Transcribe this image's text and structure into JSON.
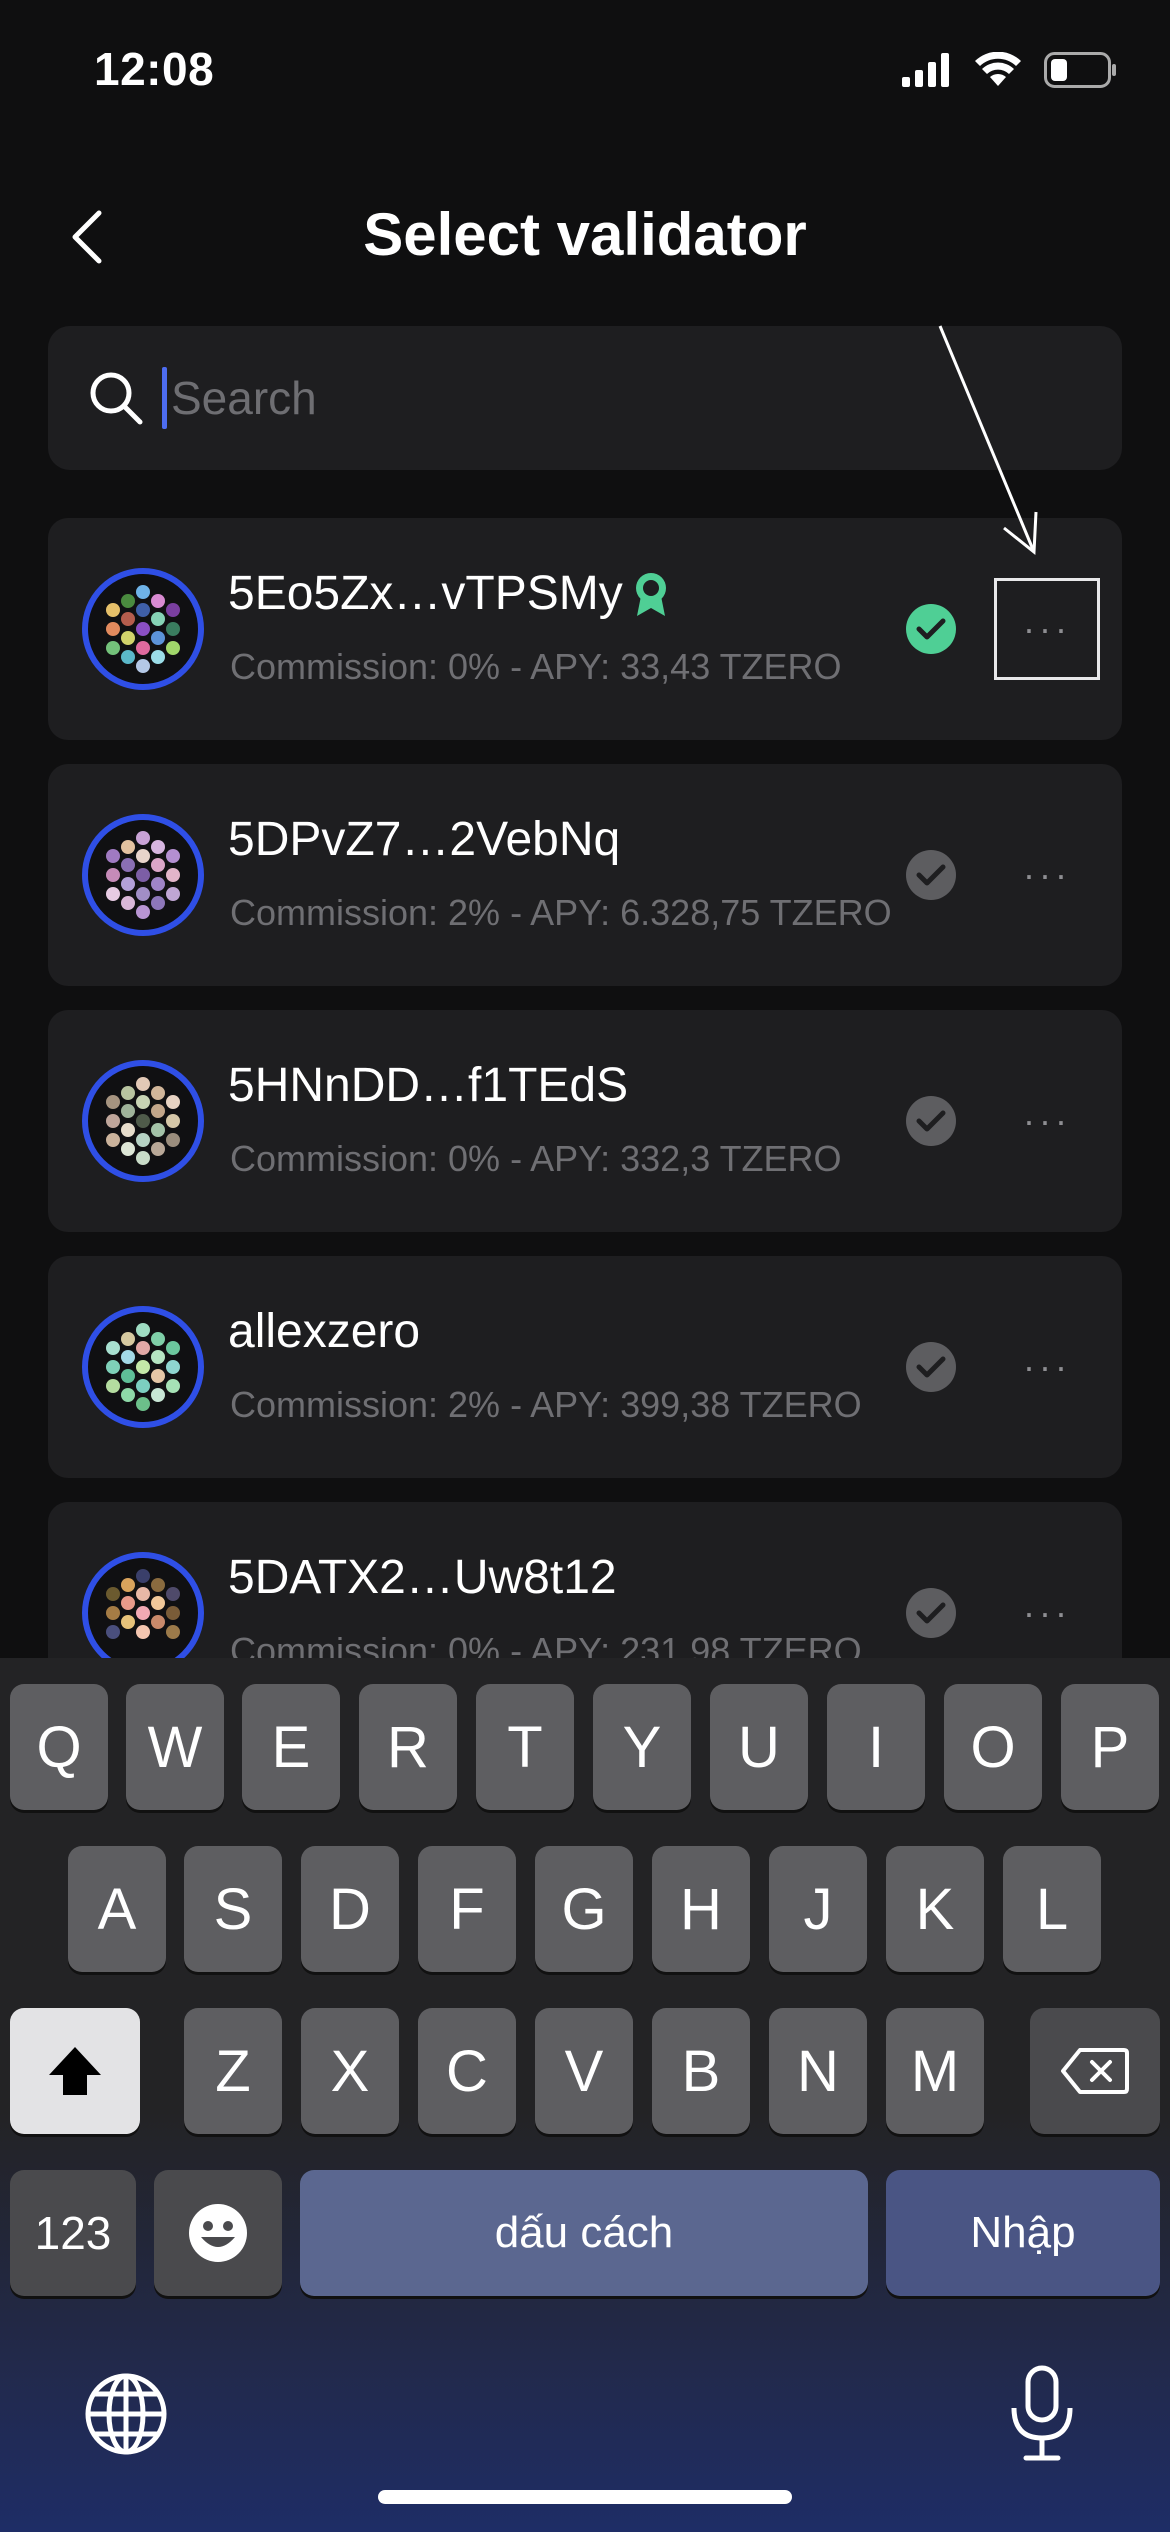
{
  "status_bar": {
    "time": "12:08"
  },
  "header": {
    "title": "Select validator"
  },
  "search": {
    "placeholder": "Search",
    "value": ""
  },
  "colors": {
    "accent": "#2f4fe6",
    "selected_check": "#4fcf95",
    "card_bg": "#1e1e20",
    "meta_text": "#6f6f73"
  },
  "validators": [
    {
      "name": "5Eo5Zx…vTPSMy",
      "badge": "ribbon-badge-icon",
      "meta": "Commission: 0% - APY: 33,43 TZERO",
      "selected": true,
      "more_label": "···"
    },
    {
      "name": "5DPvZ7…2VebNq",
      "meta": "Commission: 2% - APY: 6.328,75 TZERO",
      "selected": false,
      "more_label": "···"
    },
    {
      "name": "5HNnDD…f1TEdS",
      "meta": "Commission: 0% - APY: 332,3 TZERO",
      "selected": false,
      "more_label": "···"
    },
    {
      "name": "allexzero",
      "meta": "Commission: 2% - APY: 399,38 TZERO",
      "selected": false,
      "more_label": "···"
    },
    {
      "name": "5DATX2…Uw8t12",
      "meta": "Commission: 0% - APY: 231,98 TZERO",
      "selected": false,
      "more_label": "···"
    }
  ],
  "keyboard": {
    "row1": [
      "Q",
      "W",
      "E",
      "R",
      "T",
      "Y",
      "U",
      "I",
      "O",
      "P"
    ],
    "row2": [
      "A",
      "S",
      "D",
      "F",
      "G",
      "H",
      "J",
      "K",
      "L"
    ],
    "row3": [
      "Z",
      "X",
      "C",
      "V",
      "B",
      "N",
      "M"
    ],
    "numbers_label": "123",
    "space_label": "dấu cách",
    "return_label": "Nhập"
  }
}
